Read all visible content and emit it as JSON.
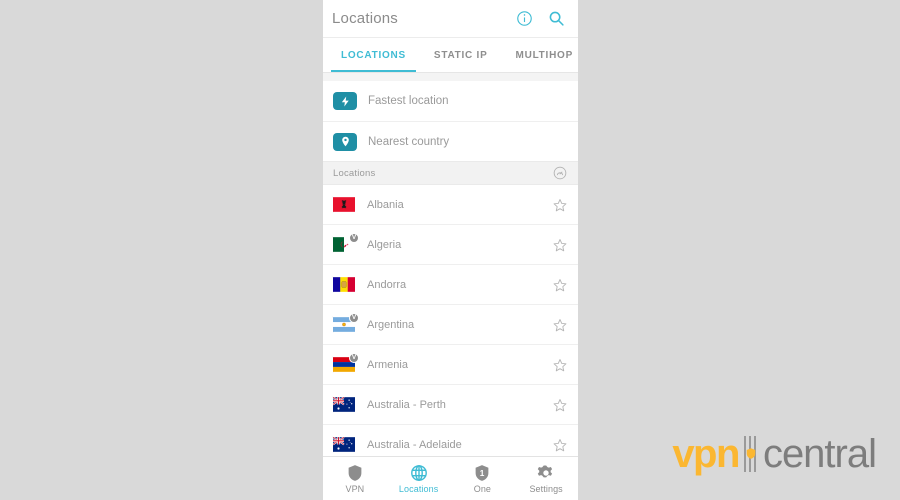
{
  "theme": {
    "page_background": "#d9d9d9",
    "panel_background": "#ffffff",
    "accent": "#3fbcd4",
    "badge_teal": "#1f8fa5",
    "muted_text": "#9a9a9a",
    "watermark_orange": "#fbb731",
    "watermark_gray": "#7d7d7d"
  },
  "header": {
    "title": "Locations",
    "info_icon": "info-circle-icon",
    "search_icon": "search-icon"
  },
  "tabs": [
    {
      "label": "LOCATIONS",
      "active": true
    },
    {
      "label": "STATIC IP",
      "active": false
    },
    {
      "label": "MULTIHOP",
      "active": false
    }
  ],
  "quick_options": [
    {
      "label": "Fastest location",
      "icon": "lightning-bolt-icon"
    },
    {
      "label": "Nearest country",
      "icon": "map-pin-icon"
    }
  ],
  "section": {
    "title": "Locations",
    "icon": "speedometer-icon"
  },
  "locations": [
    {
      "name": "Albania",
      "flag": "albania",
      "virtual": false,
      "favorite": false
    },
    {
      "name": "Algeria",
      "flag": "algeria",
      "virtual": true,
      "favorite": false
    },
    {
      "name": "Andorra",
      "flag": "andorra",
      "virtual": false,
      "favorite": false
    },
    {
      "name": "Argentina",
      "flag": "argentina",
      "virtual": true,
      "favorite": false
    },
    {
      "name": "Armenia",
      "flag": "armenia",
      "virtual": true,
      "favorite": false
    },
    {
      "name": "Australia - Perth",
      "flag": "australia",
      "virtual": false,
      "favorite": false
    },
    {
      "name": "Australia - Adelaide",
      "flag": "australia",
      "virtual": false,
      "favorite": false
    }
  ],
  "virtual_badge_letter": "V",
  "bottom_nav": [
    {
      "label": "VPN",
      "icon": "shield-icon",
      "active": false
    },
    {
      "label": "Locations",
      "icon": "globe-icon",
      "active": true
    },
    {
      "label": "One",
      "icon": "shield-one-icon",
      "active": false
    },
    {
      "label": "Settings",
      "icon": "gear-icon",
      "active": false
    }
  ],
  "watermark": {
    "first": "vpn",
    "second": "central"
  }
}
